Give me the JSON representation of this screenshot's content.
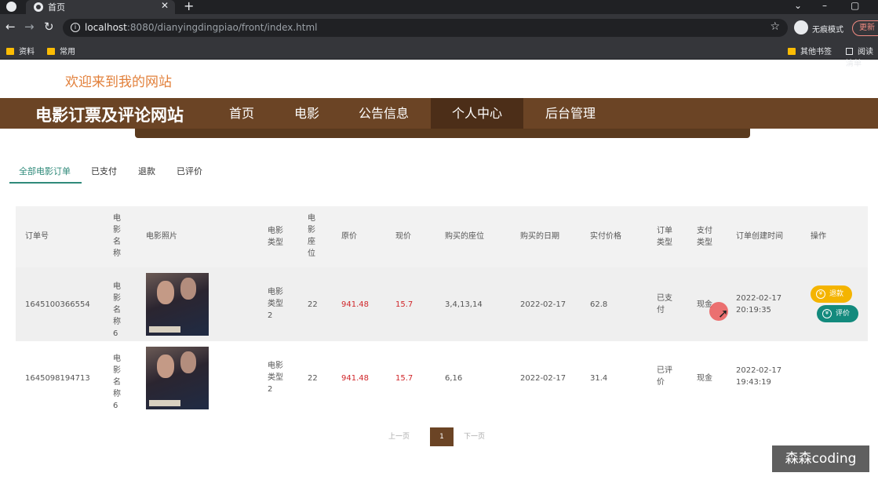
{
  "browser": {
    "tab_title": "首页",
    "tab_close": "✕",
    "new_tab": "+",
    "url_host": "localhost",
    "url_rest": ":8080/dianyingdingpiao/front/index.html",
    "incognito_label": "无痕模式",
    "update_label": "更新",
    "bookmarks": [
      "资料",
      "常用"
    ],
    "other_bookmarks": "其他书签",
    "reading_list": "阅读清单"
  },
  "site": {
    "welcome": "欢迎来到我的网站",
    "brand": "电影订票及评论网站",
    "nav": [
      "首页",
      "电影",
      "公告信息",
      "个人中心",
      "后台管理"
    ],
    "active_nav": "个人中心"
  },
  "subtabs": [
    "全部电影订单",
    "已支付",
    "退款",
    "已评价"
  ],
  "table": {
    "headers": {
      "order_no": "订单号",
      "movie_name": "电影名称",
      "movie_photo": "电影照片",
      "movie_type": "电影类型",
      "movie_seat": "电影座位",
      "orig_price": "原价",
      "cur_price": "现价",
      "seats": "购买的座位",
      "date": "购买的日期",
      "paid": "实付价格",
      "order_type": "订单类型",
      "pay_type": "支付类型",
      "created": "订单创建时间",
      "action": "操作"
    },
    "rows": [
      {
        "order_no": "1645100366554",
        "movie_name": "电影名称6",
        "movie_type": "电影类型2",
        "movie_seat": "22",
        "orig_price": "941.48",
        "cur_price": "15.7",
        "seats": "3,4,13,14",
        "date": "2022-02-17",
        "paid": "62.8",
        "order_type": "已支付",
        "pay_type": "现金",
        "created_date": "2022-02-17",
        "created_time": "20:19:35",
        "btn_refund": "退款",
        "btn_review": "评价"
      },
      {
        "order_no": "1645098194713",
        "movie_name": "电影名称6",
        "movie_type": "电影类型2",
        "movie_seat": "22",
        "orig_price": "941.48",
        "cur_price": "15.7",
        "seats": "6,16",
        "date": "2022-02-17",
        "paid": "31.4",
        "order_type": "已评价",
        "pay_type": "现金",
        "created_date": "2022-02-17",
        "created_time": "19:43:19"
      }
    ]
  },
  "pager": {
    "prev": "上一页",
    "page": "1",
    "next": "下一页"
  },
  "watermark": "森森coding",
  "colors": {
    "brand_brown": "#6b4425",
    "active_nav": "#4c2e18",
    "teal": "#138a7d",
    "refund_yellow": "#f4b400",
    "price_red": "#d0262a"
  }
}
